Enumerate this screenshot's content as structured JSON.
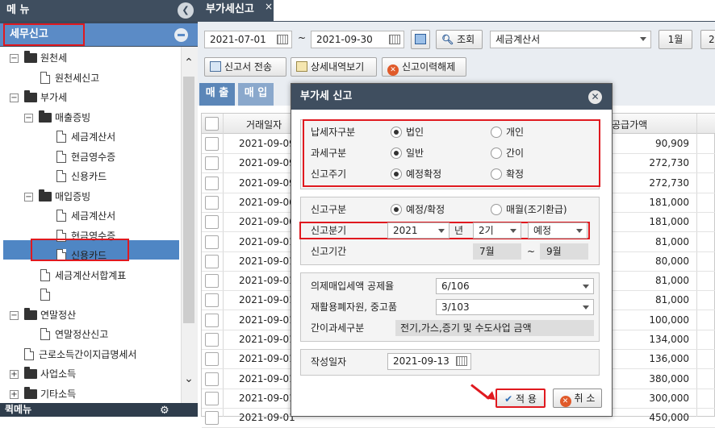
{
  "sidebar": {
    "title": "메 뉴",
    "section": "세무신고",
    "tree": [
      {
        "label": "원천세",
        "type": "folder",
        "exp": "−"
      },
      {
        "label": "원천세신고",
        "type": "doc"
      },
      {
        "label": "부가세",
        "type": "folder",
        "exp": "−"
      },
      {
        "label": "매출증빙",
        "type": "folder",
        "exp": "−"
      },
      {
        "label": "세금계산서",
        "type": "doc"
      },
      {
        "label": "현금영수증",
        "type": "doc"
      },
      {
        "label": "신용카드",
        "type": "doc"
      },
      {
        "label": "매입증빙",
        "type": "folder",
        "exp": "−"
      },
      {
        "label": "세금계산서",
        "type": "doc"
      },
      {
        "label": "현금영수증",
        "type": "doc"
      },
      {
        "label": "신용카드",
        "type": "doc"
      },
      {
        "label": "세금계산서합계표",
        "type": "doc"
      },
      {
        "label": "부가세신고",
        "type": "doc"
      },
      {
        "label": "연말정산",
        "type": "folder",
        "exp": "−"
      },
      {
        "label": "연말정산신고",
        "type": "doc"
      },
      {
        "label": "근로소득간이지급명세서",
        "type": "doc"
      },
      {
        "label": "사업소득",
        "type": "folder",
        "exp": "+"
      },
      {
        "label": "기타소득",
        "type": "folder",
        "exp": "+"
      }
    ],
    "quick_menu": "퀵메뉴"
  },
  "tab": {
    "title": "부가세신고",
    "close": "×"
  },
  "toolbar": {
    "date_from": "2021-07-01",
    "tilde": "~",
    "date_to": "2021-09-30",
    "search_label": "조회",
    "doc_type": "세금계산서",
    "month1": "1월",
    "month2": "2",
    "send_label": "신고서 전송",
    "detail_label": "상세내역보기",
    "cancel_label": "신고이력해제"
  },
  "subtabs": {
    "sales": "매 출",
    "purchase": "매 입"
  },
  "grid": {
    "col_date": "거래일자",
    "col_amount": "공급가액",
    "rows": [
      {
        "date": "2021-09-09",
        "amount": "90,909"
      },
      {
        "date": "2021-09-09",
        "amount": "272,730"
      },
      {
        "date": "2021-09-09",
        "amount": "272,730"
      },
      {
        "date": "2021-09-06",
        "amount": "181,000"
      },
      {
        "date": "2021-09-06",
        "amount": "181,000"
      },
      {
        "date": "2021-09-01",
        "amount": "81,000"
      },
      {
        "date": "2021-09-01",
        "amount": "80,000"
      },
      {
        "date": "2021-09-01",
        "amount": "81,000"
      },
      {
        "date": "2021-09-01",
        "amount": "81,000"
      },
      {
        "date": "2021-09-01",
        "amount": "100,000"
      },
      {
        "date": "2021-09-01",
        "amount": "134,000"
      },
      {
        "date": "2021-09-01",
        "amount": "136,000"
      },
      {
        "date": "2021-09-01",
        "amount": "380,000"
      },
      {
        "date": "2021-09-01",
        "amount": "300,000"
      },
      {
        "date": "2021-09-01",
        "amount": "450,000"
      }
    ]
  },
  "modal": {
    "title": "부가세 신고",
    "taxpayer_label": "납세자구분",
    "taxpayer_opt1": "법인",
    "taxpayer_opt2": "개인",
    "taxtype_label": "과세구분",
    "taxtype_opt1": "일반",
    "taxtype_opt2": "간이",
    "cycle_label": "신고주기",
    "cycle_opt1": "예정확정",
    "cycle_opt2": "확정",
    "report_type_label": "신고구분",
    "report_opt1": "예정/확정",
    "report_opt2": "매월(조기환급)",
    "quarter_label": "신고분기",
    "year_value": "2021",
    "year_unit": "년",
    "period_value": "2기",
    "kind_value": "예정",
    "term_label": "신고기간",
    "term_from": "7월",
    "term_tilde": "~",
    "term_to": "9월",
    "deemed_label": "의제매입세액 공제율",
    "deemed_value": "6/106",
    "recycle_label": "재활용폐자원, 중고품",
    "recycle_value": "3/103",
    "simple_label": "간이과세구분",
    "simple_value": "전기,가스,증기 및 수도사업 금액",
    "written_label": "작성일자",
    "written_value": "2021-09-13",
    "apply_label": "적 용",
    "cancel_label": "취 소"
  }
}
